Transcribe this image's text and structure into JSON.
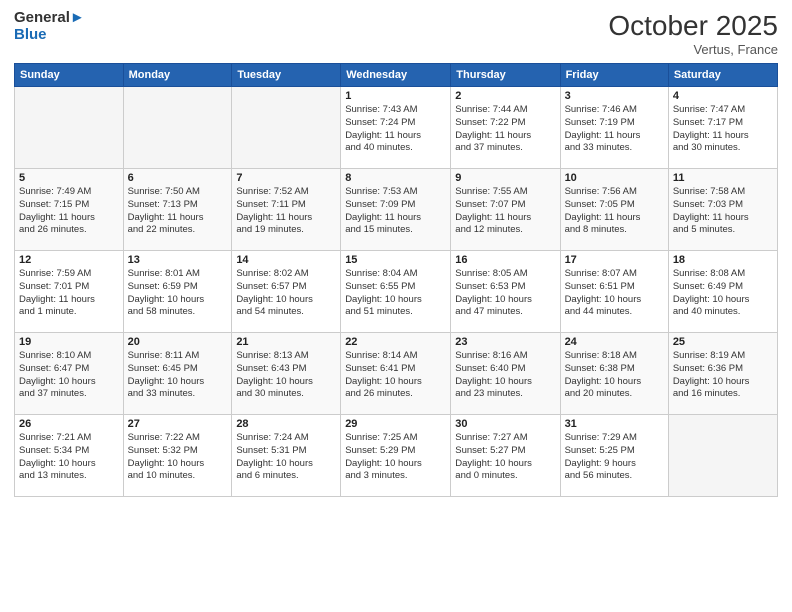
{
  "header": {
    "logo_line1": "General",
    "logo_line2": "Blue",
    "month": "October 2025",
    "location": "Vertus, France"
  },
  "weekdays": [
    "Sunday",
    "Monday",
    "Tuesday",
    "Wednesday",
    "Thursday",
    "Friday",
    "Saturday"
  ],
  "weeks": [
    [
      {
        "day": "",
        "info": ""
      },
      {
        "day": "",
        "info": ""
      },
      {
        "day": "",
        "info": ""
      },
      {
        "day": "1",
        "info": "Sunrise: 7:43 AM\nSunset: 7:24 PM\nDaylight: 11 hours\nand 40 minutes."
      },
      {
        "day": "2",
        "info": "Sunrise: 7:44 AM\nSunset: 7:22 PM\nDaylight: 11 hours\nand 37 minutes."
      },
      {
        "day": "3",
        "info": "Sunrise: 7:46 AM\nSunset: 7:19 PM\nDaylight: 11 hours\nand 33 minutes."
      },
      {
        "day": "4",
        "info": "Sunrise: 7:47 AM\nSunset: 7:17 PM\nDaylight: 11 hours\nand 30 minutes."
      }
    ],
    [
      {
        "day": "5",
        "info": "Sunrise: 7:49 AM\nSunset: 7:15 PM\nDaylight: 11 hours\nand 26 minutes."
      },
      {
        "day": "6",
        "info": "Sunrise: 7:50 AM\nSunset: 7:13 PM\nDaylight: 11 hours\nand 22 minutes."
      },
      {
        "day": "7",
        "info": "Sunrise: 7:52 AM\nSunset: 7:11 PM\nDaylight: 11 hours\nand 19 minutes."
      },
      {
        "day": "8",
        "info": "Sunrise: 7:53 AM\nSunset: 7:09 PM\nDaylight: 11 hours\nand 15 minutes."
      },
      {
        "day": "9",
        "info": "Sunrise: 7:55 AM\nSunset: 7:07 PM\nDaylight: 11 hours\nand 12 minutes."
      },
      {
        "day": "10",
        "info": "Sunrise: 7:56 AM\nSunset: 7:05 PM\nDaylight: 11 hours\nand 8 minutes."
      },
      {
        "day": "11",
        "info": "Sunrise: 7:58 AM\nSunset: 7:03 PM\nDaylight: 11 hours\nand 5 minutes."
      }
    ],
    [
      {
        "day": "12",
        "info": "Sunrise: 7:59 AM\nSunset: 7:01 PM\nDaylight: 11 hours\nand 1 minute."
      },
      {
        "day": "13",
        "info": "Sunrise: 8:01 AM\nSunset: 6:59 PM\nDaylight: 10 hours\nand 58 minutes."
      },
      {
        "day": "14",
        "info": "Sunrise: 8:02 AM\nSunset: 6:57 PM\nDaylight: 10 hours\nand 54 minutes."
      },
      {
        "day": "15",
        "info": "Sunrise: 8:04 AM\nSunset: 6:55 PM\nDaylight: 10 hours\nand 51 minutes."
      },
      {
        "day": "16",
        "info": "Sunrise: 8:05 AM\nSunset: 6:53 PM\nDaylight: 10 hours\nand 47 minutes."
      },
      {
        "day": "17",
        "info": "Sunrise: 8:07 AM\nSunset: 6:51 PM\nDaylight: 10 hours\nand 44 minutes."
      },
      {
        "day": "18",
        "info": "Sunrise: 8:08 AM\nSunset: 6:49 PM\nDaylight: 10 hours\nand 40 minutes."
      }
    ],
    [
      {
        "day": "19",
        "info": "Sunrise: 8:10 AM\nSunset: 6:47 PM\nDaylight: 10 hours\nand 37 minutes."
      },
      {
        "day": "20",
        "info": "Sunrise: 8:11 AM\nSunset: 6:45 PM\nDaylight: 10 hours\nand 33 minutes."
      },
      {
        "day": "21",
        "info": "Sunrise: 8:13 AM\nSunset: 6:43 PM\nDaylight: 10 hours\nand 30 minutes."
      },
      {
        "day": "22",
        "info": "Sunrise: 8:14 AM\nSunset: 6:41 PM\nDaylight: 10 hours\nand 26 minutes."
      },
      {
        "day": "23",
        "info": "Sunrise: 8:16 AM\nSunset: 6:40 PM\nDaylight: 10 hours\nand 23 minutes."
      },
      {
        "day": "24",
        "info": "Sunrise: 8:18 AM\nSunset: 6:38 PM\nDaylight: 10 hours\nand 20 minutes."
      },
      {
        "day": "25",
        "info": "Sunrise: 8:19 AM\nSunset: 6:36 PM\nDaylight: 10 hours\nand 16 minutes."
      }
    ],
    [
      {
        "day": "26",
        "info": "Sunrise: 7:21 AM\nSunset: 5:34 PM\nDaylight: 10 hours\nand 13 minutes."
      },
      {
        "day": "27",
        "info": "Sunrise: 7:22 AM\nSunset: 5:32 PM\nDaylight: 10 hours\nand 10 minutes."
      },
      {
        "day": "28",
        "info": "Sunrise: 7:24 AM\nSunset: 5:31 PM\nDaylight: 10 hours\nand 6 minutes."
      },
      {
        "day": "29",
        "info": "Sunrise: 7:25 AM\nSunset: 5:29 PM\nDaylight: 10 hours\nand 3 minutes."
      },
      {
        "day": "30",
        "info": "Sunrise: 7:27 AM\nSunset: 5:27 PM\nDaylight: 10 hours\nand 0 minutes."
      },
      {
        "day": "31",
        "info": "Sunrise: 7:29 AM\nSunset: 5:25 PM\nDaylight: 9 hours\nand 56 minutes."
      },
      {
        "day": "",
        "info": ""
      }
    ]
  ]
}
